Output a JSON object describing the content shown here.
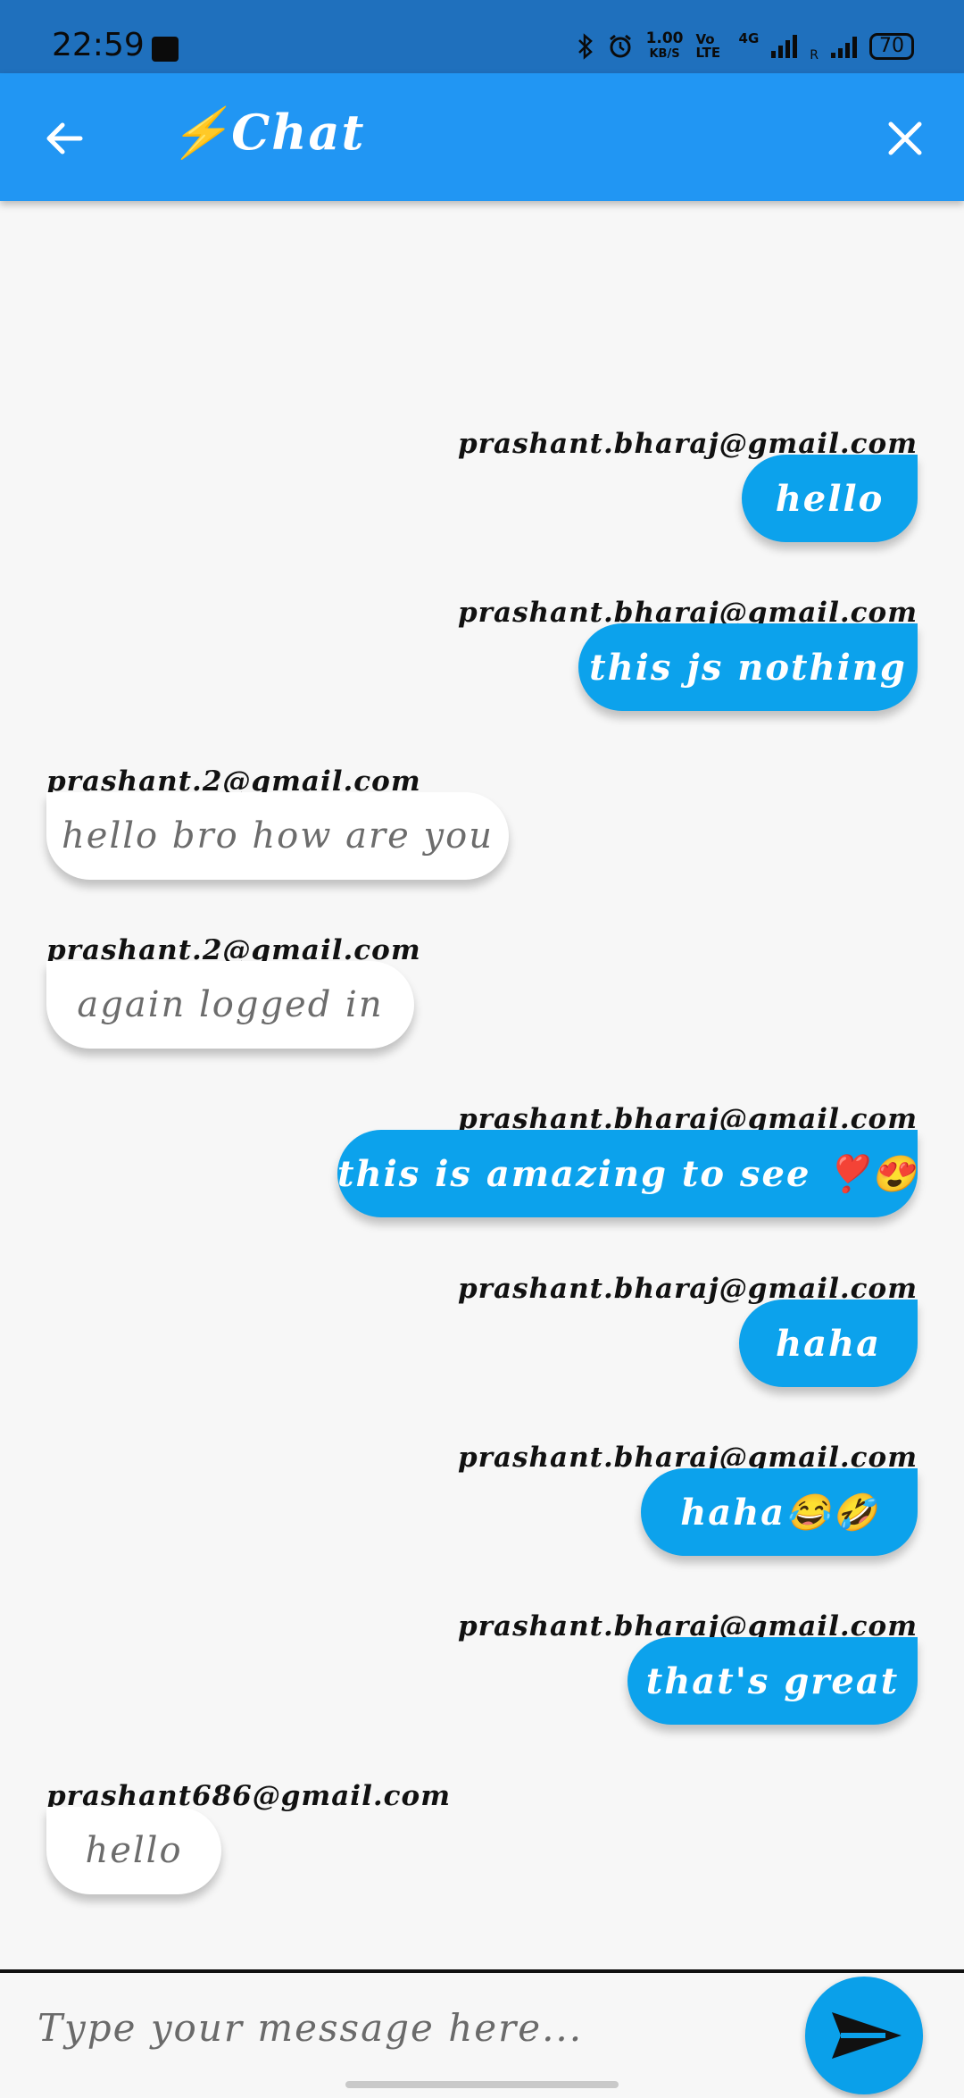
{
  "status_bar": {
    "time": "22:59",
    "net_speed_value": "1.00",
    "net_speed_unit": "KB/S",
    "volte_label": "Vo LTE",
    "network_label": "4G",
    "roaming_label": "R",
    "battery": "70",
    "icons": [
      "translate-icon",
      "bluetooth-icon",
      "alarm-icon",
      "signal-icon",
      "battery-icon"
    ]
  },
  "app_bar": {
    "title": "⚡Chat",
    "back_icon": "arrow-left-icon",
    "close_icon": "close-icon",
    "color": "#2196f3"
  },
  "messages": [
    {
      "sender": "prashant.bharaj@gmail.com",
      "text": "hello",
      "side": "right"
    },
    {
      "sender": "prashant.bharaj@gmail.com",
      "text": "this js nothing",
      "side": "right"
    },
    {
      "sender": "prashant.2@gmail.com",
      "text": "hello bro how are you",
      "side": "left"
    },
    {
      "sender": "prashant.2@gmail.com",
      "text": "again logged in",
      "side": "left"
    },
    {
      "sender": "prashant.bharaj@gmail.com",
      "text": "this is amazing to see ❣️😍",
      "side": "right"
    },
    {
      "sender": "prashant.bharaj@gmail.com",
      "text": "haha",
      "side": "right"
    },
    {
      "sender": "prashant.bharaj@gmail.com",
      "text": "haha😂🤣",
      "side": "right"
    },
    {
      "sender": "prashant.bharaj@gmail.com",
      "text": "that's great",
      "side": "right"
    },
    {
      "sender": "prashant686@gmail.com",
      "text": "hello",
      "side": "left"
    }
  ],
  "composer": {
    "placeholder": "Type your message here...",
    "value": "",
    "send_icon": "send-icon"
  },
  "colors": {
    "outgoing_bubble": "#0ca2ec",
    "incoming_bubble": "#ffffff",
    "background": "#f7f7f7"
  }
}
